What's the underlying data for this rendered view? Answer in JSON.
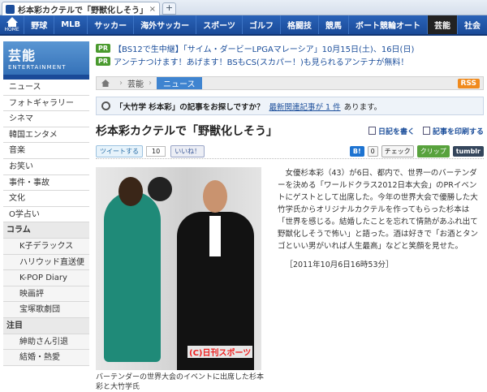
{
  "browser": {
    "tab_title": "杉本彩カクテルで「野獣化しそう」 -",
    "close": "×",
    "newtab": "+"
  },
  "nav": {
    "home_label": "HOME",
    "items": [
      "野球",
      "MLB",
      "サッカー",
      "海外サッカー",
      "スポーツ",
      "ゴルフ",
      "格闘技",
      "競馬",
      "ボート競輪オート",
      "芸能",
      "社会"
    ],
    "active": "芸能"
  },
  "brand": {
    "title": "芸能",
    "subtitle": "ENTERTAINMENT"
  },
  "sidebar": [
    {
      "label": "ニュース",
      "kind": "item"
    },
    {
      "label": "フォトギャラリー",
      "kind": "item"
    },
    {
      "label": "シネマ",
      "kind": "item"
    },
    {
      "label": "韓国エンタメ",
      "kind": "item"
    },
    {
      "label": "音楽",
      "kind": "item"
    },
    {
      "label": "お笑い",
      "kind": "item"
    },
    {
      "label": "事件・事故",
      "kind": "item"
    },
    {
      "label": "文化",
      "kind": "item"
    },
    {
      "label": "O学占い",
      "kind": "item"
    },
    {
      "label": "コラム",
      "kind": "sect"
    },
    {
      "label": "K子デラックス",
      "kind": "sub"
    },
    {
      "label": "ハリウッド直送便",
      "kind": "sub"
    },
    {
      "label": "K-POP Diary",
      "kind": "sub"
    },
    {
      "label": "映画評",
      "kind": "sub"
    },
    {
      "label": "宝塚歌劇団",
      "kind": "sub"
    },
    {
      "label": "注目",
      "kind": "sect"
    },
    {
      "label": "紳助さん引退",
      "kind": "sub"
    },
    {
      "label": "結婚・熱愛",
      "kind": "sub"
    }
  ],
  "pr": [
    {
      "badge": "PR",
      "text": "【BS12で生中継】「サイム・ダービーLPGAマレーシア」10月15日(土)、16日(日)"
    },
    {
      "badge": "PR",
      "text": "アンテナつけます！あげます！BSもCS(スカパー！)も見られるアンテナが無料！"
    }
  ],
  "breadcrumb": {
    "items": [
      "芸能",
      "ニュース"
    ],
    "sep": "›",
    "rss": "RSS"
  },
  "notice": {
    "query": "「大竹学 杉本彩」の記事をお探しですか？",
    "link": "最新関連記事が 1 件",
    "tail": "あります。"
  },
  "article": {
    "title": "杉本彩カクテルで「野獣化しそう」",
    "action_write": "日記を書く",
    "action_print": "記事を印刷する",
    "tweet": "ツイートする",
    "tweet_count": "10",
    "like": "いいね！",
    "b_count": "0",
    "check": "チェック",
    "clip": "クリップ",
    "tumblr": "tumblr",
    "body": "女優杉本彩（43）が6日、都内で、世界一のバーテンダーを決める「ワールドクラス2012日本大会」のPRイベントにゲストとして出席した。今年の世界大会で優勝した大竹学氏からオリジナルカクテルを作ってもらった杉本は「世界を感じる。結婚したことを忘れて情熱があふれ出て野獣化しそうで怖い」と語った。酒は好きで「お酒とタンゴといい男がいれば人生最高」などと笑顔を見せた。",
    "date": "［2011年10月6日16時53分］",
    "photo_credit": "(C)日刊スポーツ",
    "caption": "バーテンダーの世界大会のイベントに出席した杉本彩と大竹学氏"
  },
  "colors": {
    "nav": "#1a4a98",
    "brand": "#3f84d0",
    "active_nav": "#222222"
  }
}
